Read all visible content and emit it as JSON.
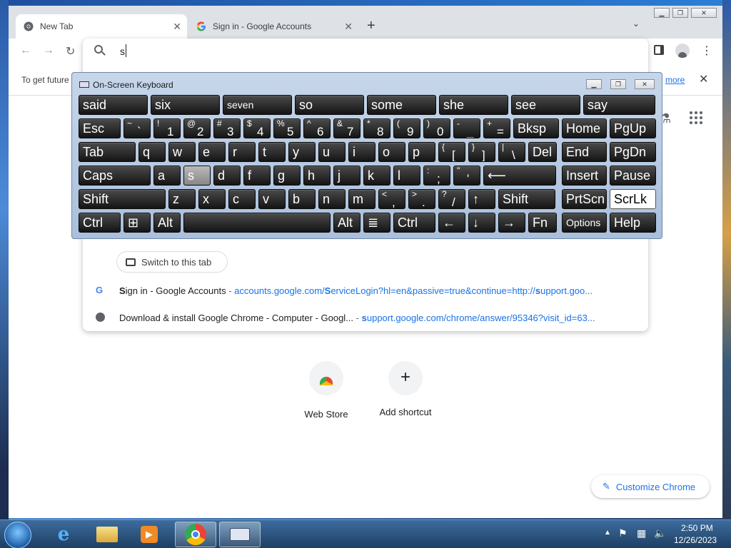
{
  "browser": {
    "tabs": [
      {
        "label": "New Tab",
        "active": true
      },
      {
        "label": "Sign in - Google Accounts",
        "active": false
      }
    ],
    "omnibox_value": "s",
    "infobar_text": "To get future",
    "infobar_link": "more",
    "suggestions": {
      "switch_tab_label": "Switch to this tab",
      "items": [
        {
          "title_bold": "S",
          "title_rest": "ign in - Google Accounts",
          "url_pre": "accounts.google.com/",
          "url_bold": "S",
          "url_mid": "erviceLogin?hl=en&passive=true&continue=http://",
          "url_bold2": "s",
          "url_rest": "upport.goo..."
        },
        {
          "title": "Download & install Google Chrome - Computer - Googl...",
          "url_bold": "s",
          "url_rest": "upport.google.com/chrome/answer/95346?visit_id=63..."
        }
      ]
    },
    "shortcuts": [
      {
        "label": "Web Store"
      },
      {
        "label": "Add shortcut"
      }
    ],
    "customize_label": "Customize Chrome",
    "colors": {
      "link": "#1a73e8",
      "active_key": "#ffffff"
    }
  },
  "osk": {
    "title": "On-Screen Keyboard",
    "predictions": [
      "said",
      "six",
      "seven",
      "so",
      "some",
      "she",
      "see",
      "say"
    ],
    "row1": [
      {
        "label": "Esc"
      },
      {
        "sup": "~",
        "main": "`"
      },
      {
        "sup": "!",
        "main": "1"
      },
      {
        "sup": "@",
        "main": "2"
      },
      {
        "sup": "#",
        "main": "3"
      },
      {
        "sup": "$",
        "main": "4"
      },
      {
        "sup": "%",
        "main": "5"
      },
      {
        "sup": "^",
        "main": "6"
      },
      {
        "sup": "&",
        "main": "7"
      },
      {
        "sup": "*",
        "main": "8"
      },
      {
        "sup": "(",
        "main": "9"
      },
      {
        "sup": ")",
        "main": "0"
      },
      {
        "sup": "-",
        "main": "_"
      },
      {
        "sup": "+",
        "main": "="
      },
      {
        "label": "Bksp"
      },
      {
        "label": "Home"
      },
      {
        "label": "PgUp"
      }
    ],
    "row2": [
      "Tab",
      "q",
      "w",
      "e",
      "r",
      "t",
      "y",
      "u",
      "i",
      "o",
      "p",
      "[",
      "]",
      "\\",
      "Del",
      "End",
      "PgDn"
    ],
    "row2_sups": [
      "",
      "",
      "",
      "",
      "",
      "",
      "",
      "",
      "",
      "",
      "",
      "{",
      "}",
      "|",
      "",
      "",
      ""
    ],
    "row3": [
      "Caps",
      "a",
      "s",
      "d",
      "f",
      "g",
      "h",
      "j",
      "k",
      "l",
      ";",
      "'",
      "⟵",
      "Insert",
      "Pause"
    ],
    "row3_sups": [
      "",
      "",
      "",
      "",
      "",
      "",
      "",
      "",
      "",
      "",
      ":",
      "\"",
      "",
      "",
      ""
    ],
    "row4": [
      "Shift",
      "z",
      "x",
      "c",
      "v",
      "b",
      "n",
      "m",
      ",",
      ".",
      "/",
      "↑",
      "Shift",
      "PrtScn",
      "ScrLk"
    ],
    "row4_sups": [
      "",
      "",
      "",
      "",
      "",
      "",
      "",
      "",
      "<",
      ">",
      "?",
      "",
      "",
      "",
      ""
    ],
    "row5": [
      "Ctrl",
      "⊞",
      "Alt",
      "",
      "Alt",
      "≣",
      "Ctrl",
      "←",
      "↓",
      "→",
      "Fn",
      "Options",
      "Help"
    ]
  },
  "taskbar": {
    "time": "2:50 PM",
    "date": "12/26/2023"
  }
}
